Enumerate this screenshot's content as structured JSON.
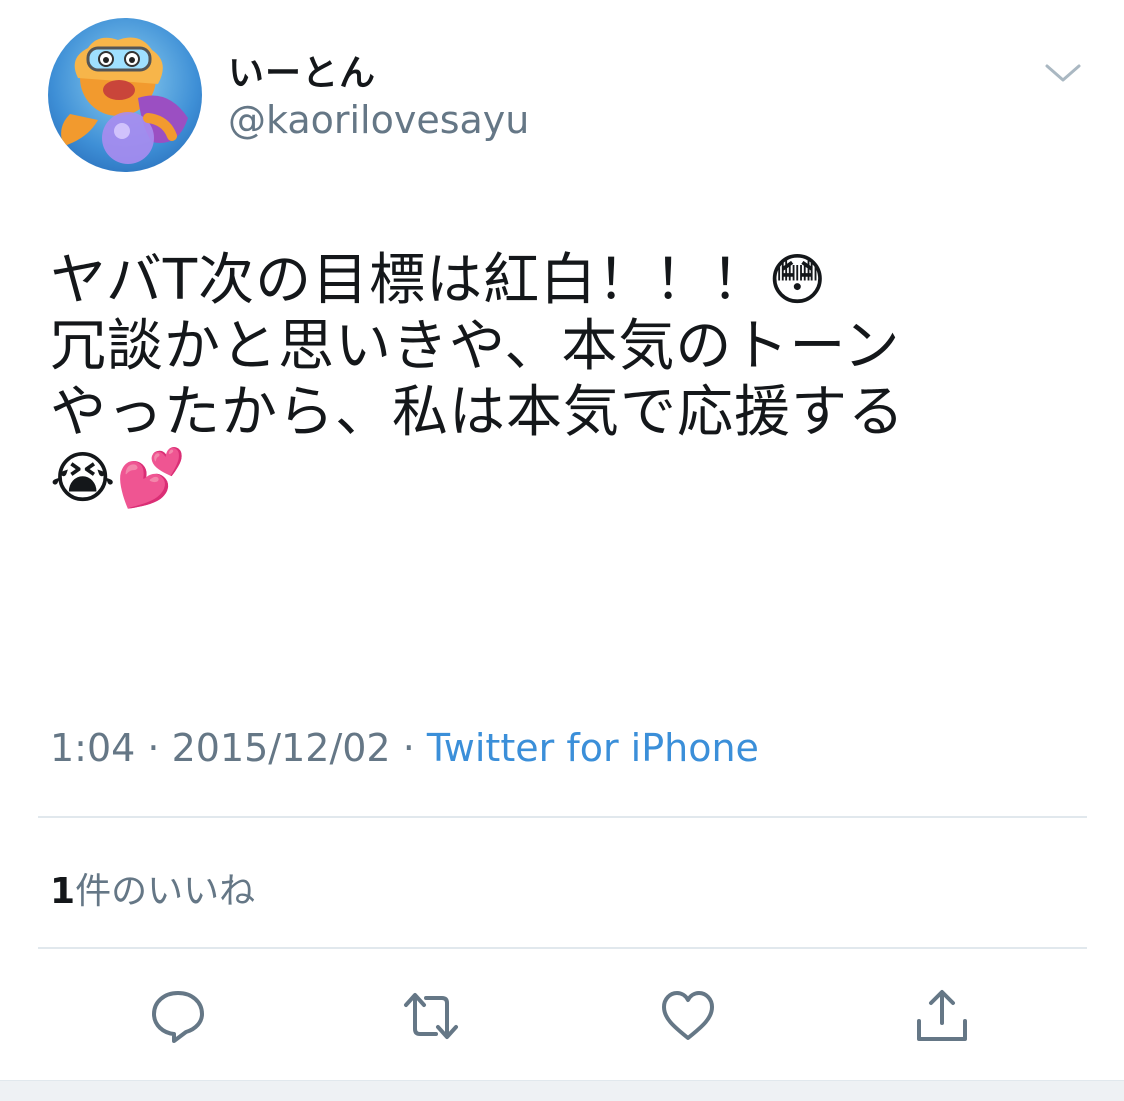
{
  "user": {
    "display_name": "いーとん",
    "handle": "@kaorilovesayu"
  },
  "tweet": {
    "lines": [
      "ヤバT次の目標は紅白！！！😳",
      "冗談かと思いきや、本気のトーン",
      "やったから、私は本気で応援する",
      "😭💕"
    ]
  },
  "meta": {
    "time": "1:04",
    "sep1": " · ",
    "date": "2015/12/02",
    "sep2": " · ",
    "source": "Twitter for iPhone"
  },
  "stats": {
    "likes_count": "1",
    "likes_label": "件のいいね"
  },
  "icons": {
    "menu": "chevron-down-icon",
    "reply": "reply-icon",
    "retweet": "retweet-icon",
    "like": "heart-icon",
    "share": "share-icon"
  },
  "colors": {
    "link": "#3b8fd9",
    "secondary_text": "#657786",
    "primary_text": "#14171a",
    "divider": "#e1e8ed"
  }
}
